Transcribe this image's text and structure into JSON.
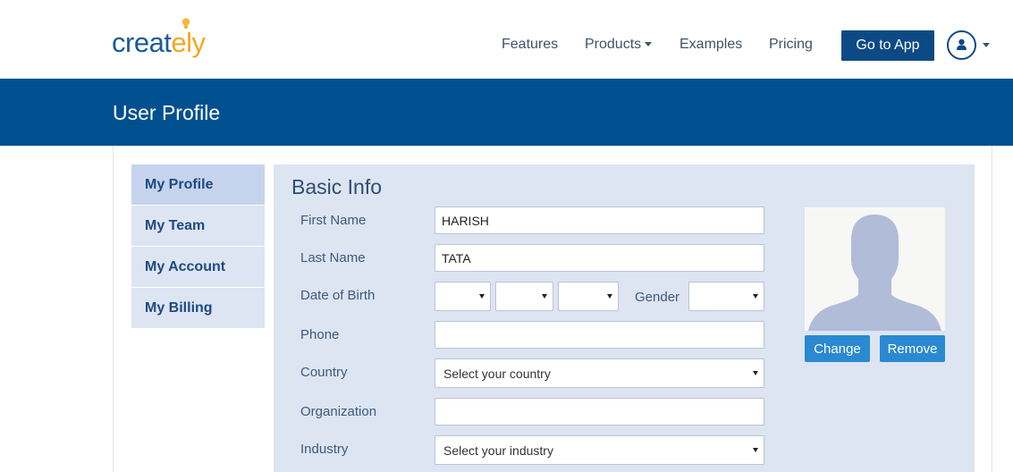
{
  "header": {
    "logo_main": "creat",
    "logo_accent": "ely",
    "nav": {
      "features": "Features",
      "products": "Products",
      "examples": "Examples",
      "pricing": "Pricing"
    },
    "go_to_app": "Go to App"
  },
  "banner": {
    "title": "User Profile"
  },
  "sidebar": {
    "items": [
      {
        "label": "My Profile",
        "active": true
      },
      {
        "label": "My Team",
        "active": false
      },
      {
        "label": "My Account",
        "active": false
      },
      {
        "label": "My Billing",
        "active": false
      }
    ]
  },
  "form": {
    "title": "Basic Info",
    "first_name": {
      "label": "First Name",
      "value": "HARISH"
    },
    "last_name": {
      "label": "Last Name",
      "value": "TATA"
    },
    "dob": {
      "label": "Date of Birth",
      "day": "",
      "month": "",
      "year": ""
    },
    "gender": {
      "label": "Gender",
      "value": ""
    },
    "phone": {
      "label": "Phone",
      "value": ""
    },
    "country": {
      "label": "Country",
      "value": "Select your country"
    },
    "organization": {
      "label": "Organization",
      "value": ""
    },
    "industry": {
      "label": "Industry",
      "value": "Select your industry"
    }
  },
  "photo": {
    "change_label": "Change",
    "remove_label": "Remove"
  },
  "colors": {
    "brand_blue": "#00508f",
    "button_blue": "#2a89d0",
    "logo_orange": "#f4a624",
    "panel_bg": "#dde4f2"
  }
}
